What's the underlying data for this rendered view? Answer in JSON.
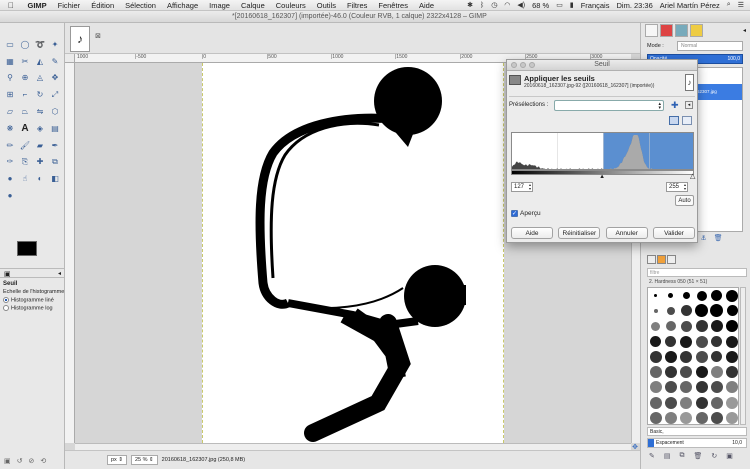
{
  "menubar": {
    "apple": "",
    "app": "GIMP",
    "items": [
      "Fichier",
      "Édition",
      "Sélection",
      "Affichage",
      "Image",
      "Calque",
      "Couleurs",
      "Outils",
      "Filtres",
      "Fenêtres",
      "Aide"
    ],
    "battery": "68 %",
    "language": "Français",
    "clock": "Dim. 23:36",
    "user": "Ariel Martín Pérez"
  },
  "image_window": {
    "title": "*[20160618_162307] (importée)-46.0 (Couleur RVB, 1 calque) 2322x4128 – GIMP",
    "ruler_labels": [
      "1000",
      "|-500",
      "|0",
      "|500",
      "|1000",
      "|1500",
      "|2000",
      "|2500",
      "|3000"
    ],
    "zoom_unit": "px",
    "zoom": "25 %",
    "status": "20160618_162307.jpg (250,8 MB)"
  },
  "toolbox": {
    "tool_options_tab": "Seuil",
    "tool_title": "Seuil",
    "scale_label": "Échelle de l'histogramme",
    "opt_linear": "Histogramme liné",
    "opt_log": "Histogramme log"
  },
  "dialog": {
    "window_title": "Seuil",
    "heading": "Appliquer les seuils",
    "subheading": "20160618_162307.jpg-92 ([20160618_162307] (importée))",
    "presets_label": "Présélections :",
    "low": "127",
    "high": "255",
    "auto": "Auto",
    "preview": "Aperçu",
    "buttons": {
      "help": "Aide",
      "reset": "Réinitialiser",
      "cancel": "Annuler",
      "ok": "Valider"
    },
    "threshold_low": 127,
    "threshold_high": 255,
    "selection_color": "#5b8fd0"
  },
  "dock": {
    "mode_label": "Mode :",
    "mode_value": "Normal",
    "opacity_label": "Opacité",
    "opacity_value": "100,0",
    "layer_name": "20160618_162307.jpg",
    "brush_filter": "filtre",
    "brush_name": "2. Hardness 050 (51 × 51)",
    "brush_tag": "Basic,",
    "spacing_label": "Espacement",
    "spacing_value": "10,0"
  }
}
